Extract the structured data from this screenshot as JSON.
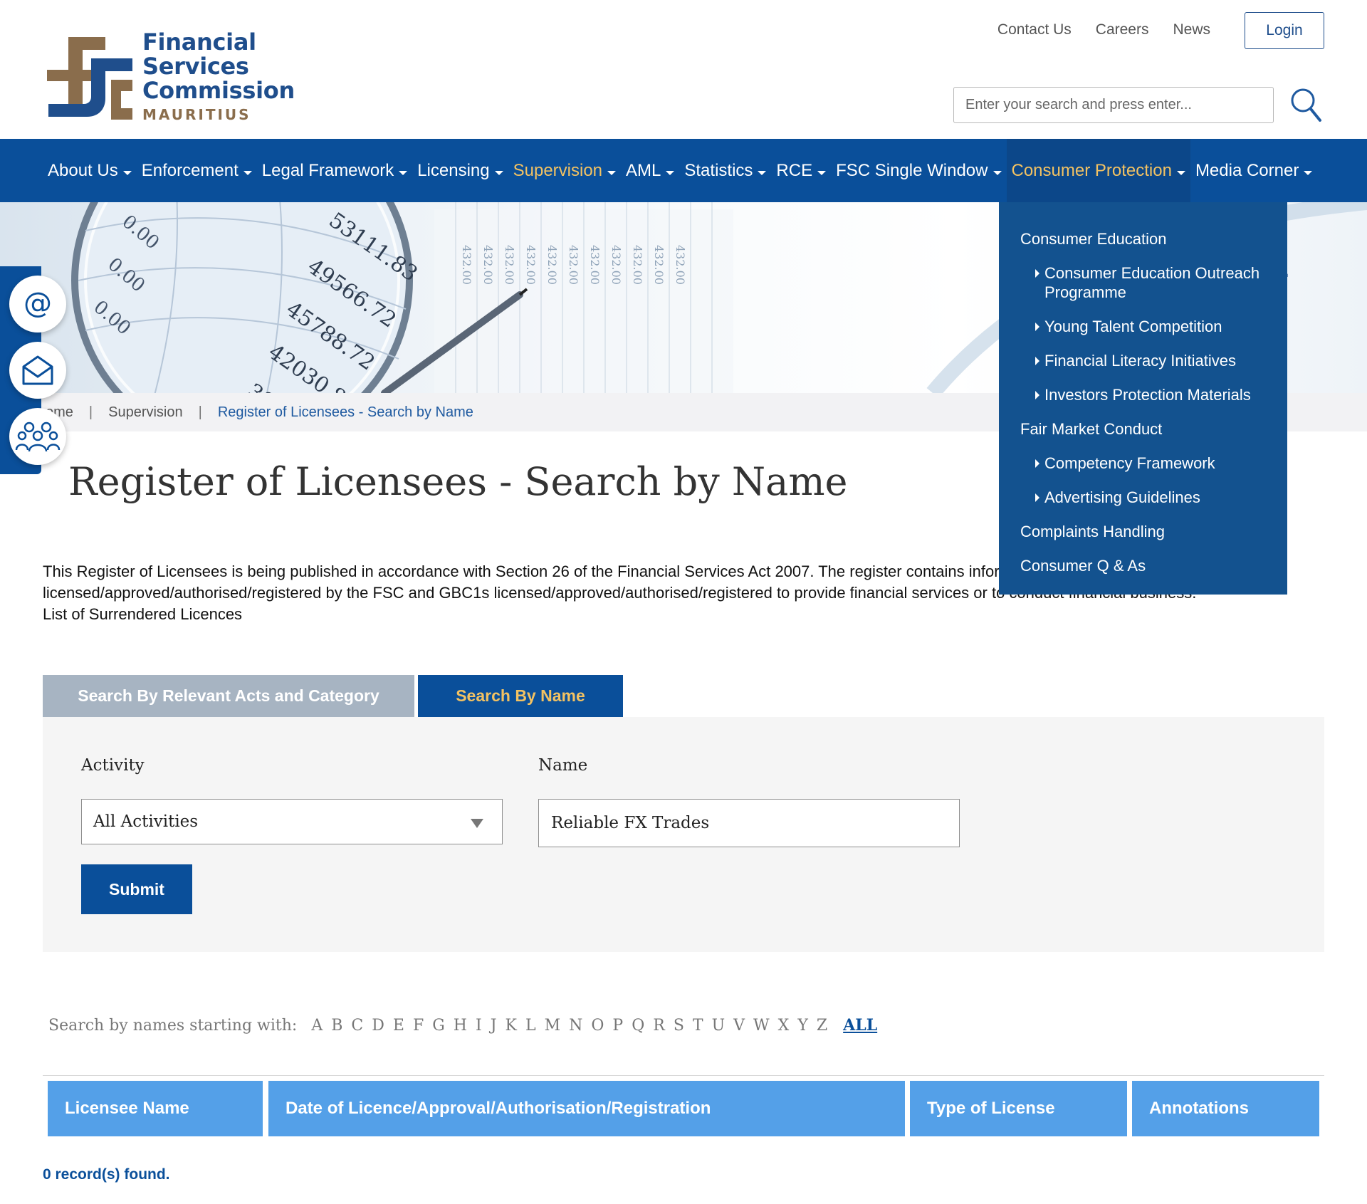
{
  "header": {
    "logo": {
      "line1": "Financial",
      "line2": "Services",
      "line3": "Commission",
      "subtitle": "MAURITIUS"
    },
    "top_links": [
      "Contact Us",
      "Careers",
      "News"
    ],
    "login_label": "Login",
    "search_placeholder": "Enter your search and press enter..."
  },
  "nav": {
    "items": [
      {
        "label": "About Us",
        "state": "normal"
      },
      {
        "label": "Enforcement",
        "state": "normal"
      },
      {
        "label": "Legal Framework",
        "state": "normal"
      },
      {
        "label": "Licensing",
        "state": "normal"
      },
      {
        "label": "Supervision",
        "state": "highlight"
      },
      {
        "label": "AML",
        "state": "normal"
      },
      {
        "label": "Statistics",
        "state": "normal"
      },
      {
        "label": "RCE",
        "state": "normal"
      },
      {
        "label": "FSC Single Window",
        "state": "normal"
      },
      {
        "label": "Consumer Protection",
        "state": "active"
      },
      {
        "label": "Media Corner",
        "state": "normal"
      }
    ]
  },
  "dropdown": {
    "items": [
      {
        "label": "Consumer Education",
        "level": "top"
      },
      {
        "label": "Consumer Education Outreach Programme",
        "level": "sub"
      },
      {
        "label": "Young Talent Competition",
        "level": "sub"
      },
      {
        "label": "Financial Literacy Initiatives",
        "level": "sub"
      },
      {
        "label": "Investors Protection Materials",
        "level": "sub"
      },
      {
        "label": "Fair Market Conduct",
        "level": "top"
      },
      {
        "label": "Competency Framework",
        "level": "sub"
      },
      {
        "label": "Advertising Guidelines",
        "level": "sub"
      },
      {
        "label": "Complaints Handling",
        "level": "top"
      },
      {
        "label": "Consumer Q & As",
        "level": "top"
      }
    ]
  },
  "hero": {
    "ghost_title": "Register of Licensees - Search by Name",
    "ghost_visible": "Licensees - Search"
  },
  "breadcrumb": {
    "home": "Home",
    "home_visible": "ome",
    "section": "Supervision",
    "current": "Register of Licensees - Search by Name"
  },
  "page_title": "Register of Licensees - Search by Name",
  "intro": {
    "paragraph": "This Register of Licensees is being published in accordance with Section 26 of the Financial Services Act 2007. The register contains information only for 'domestic' entities licensed/approved/authorised/registered by the FSC and GBC1s licensed/approved/authorised/registered to provide financial services or to conduct financial business.",
    "surrendered_link": "List of Surrendered Licences"
  },
  "tabs": {
    "acts": "Search By Relevant Acts and Category",
    "name": "Search By Name"
  },
  "form": {
    "activity_label": "Activity",
    "activity_value": "All Activities",
    "name_label": "Name",
    "name_value": "Reliable FX Trades",
    "submit_label": "Submit"
  },
  "alpha": {
    "label": "Search by names starting with:",
    "letters": [
      "A",
      "B",
      "C",
      "D",
      "E",
      "F",
      "G",
      "H",
      "I",
      "J",
      "K",
      "L",
      "M",
      "N",
      "O",
      "P",
      "Q",
      "R",
      "S",
      "T",
      "U",
      "V",
      "W",
      "X",
      "Y",
      "Z"
    ],
    "all_label": "ALL"
  },
  "table": {
    "headers": [
      "Licensee Name",
      "Date of Licence/Approval/Authorisation/Registration",
      "Type of License",
      "Annotations"
    ],
    "records_text": "0 record(s) found."
  },
  "colors": {
    "brand_blue": "#0a4f9a",
    "accent_gold": "#f3c262",
    "table_header": "#54a0e8",
    "tab_inactive": "#a7b4c2"
  }
}
